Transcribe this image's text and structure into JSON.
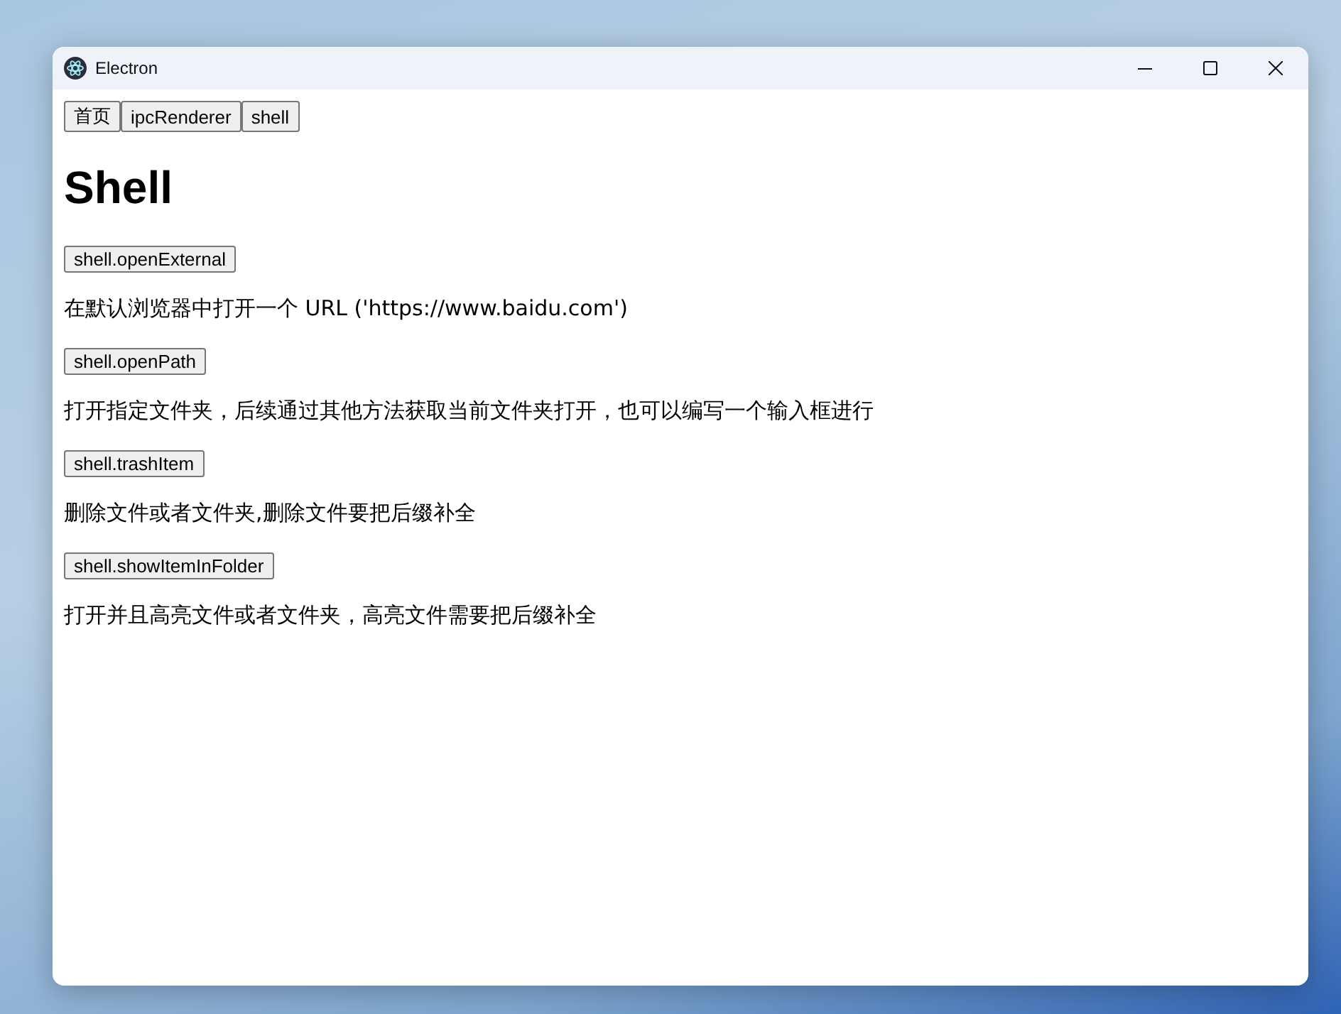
{
  "window": {
    "title": "Electron"
  },
  "nav": [
    "首页",
    "ipcRenderer",
    "shell"
  ],
  "heading": "Shell",
  "sections": [
    {
      "button": "shell.openExternal",
      "text": "在默认浏览器中打开一个 URL ('https://www.baidu.com')"
    },
    {
      "button": "shell.openPath",
      "text": "打开指定文件夹，后续通过其他方法获取当前文件夹打开，也可以编写一个输入框进行"
    },
    {
      "button": "shell.trashItem",
      "text": "删除文件或者文件夹,删除文件要把后缀补全"
    },
    {
      "button": "shell.showItemInFolder",
      "text": "打开并且高亮文件或者文件夹，高亮文件需要把后缀补全"
    }
  ]
}
